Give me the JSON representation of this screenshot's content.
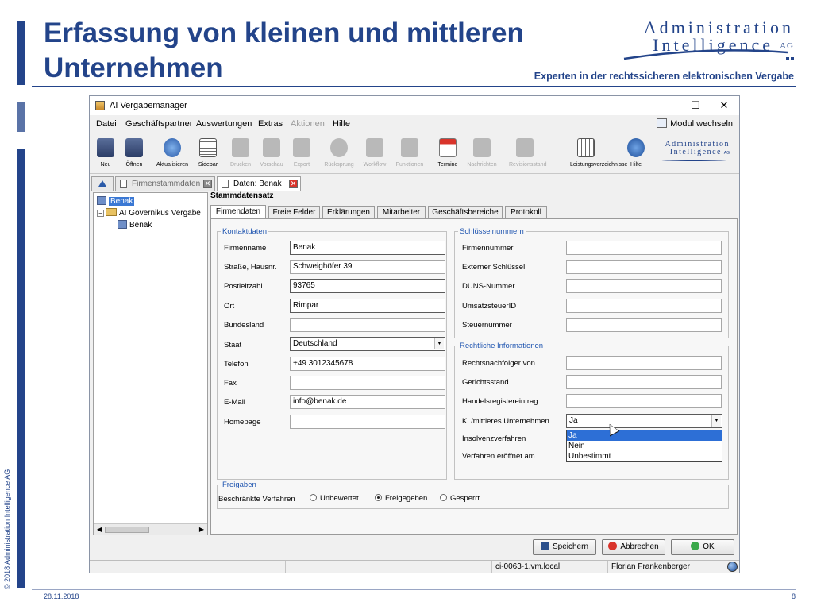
{
  "slide": {
    "title_line1": "Erfassung von kleinen und mittleren",
    "title_line2": "Unternehmen",
    "logo_line1": "Administration",
    "logo_line2": "Intelligence",
    "logo_suffix": "AG",
    "tagline": "Experten in der rechtssicheren elektronischen Vergabe",
    "footer_date": "28.11.2018",
    "page_number": "8",
    "copyright": "© 2018 Administration Intelligence AG",
    "accent_color": "#23448a"
  },
  "window": {
    "title": "AI Vergabemanager",
    "controls": {
      "minimize": "—",
      "maximize": "☐",
      "close": "✕"
    }
  },
  "menu": {
    "items": [
      "Datei",
      "Geschäftspartner",
      "Auswertungen",
      "Extras",
      "Aktionen",
      "Hilfe"
    ],
    "disabled": [
      "Aktionen"
    ],
    "modul_wechseln": "Modul wechseln"
  },
  "toolbar": {
    "buttons": [
      {
        "label": "Neu",
        "icon": "new-server-icon",
        "enabled": true
      },
      {
        "label": "Öffnen",
        "icon": "open-server-icon",
        "enabled": true
      },
      {
        "label": "Aktualisieren",
        "icon": "refresh-icon",
        "enabled": true
      },
      {
        "label": "Sidebar",
        "icon": "sidebar-icon",
        "enabled": true
      },
      {
        "label": "Drucken",
        "icon": "printer-icon",
        "enabled": false
      },
      {
        "label": "Vorschau",
        "icon": "preview-icon",
        "enabled": false
      },
      {
        "label": "Export",
        "icon": "export-icon",
        "enabled": false
      },
      {
        "label": "Rücksprung",
        "icon": "back-icon",
        "enabled": false
      },
      {
        "label": "Workflow",
        "icon": "workflow-icon",
        "enabled": false
      },
      {
        "label": "Funktionen",
        "icon": "functions-icon",
        "enabled": false
      },
      {
        "label": "Termine",
        "icon": "calendar-icon",
        "enabled": true
      },
      {
        "label": "Nachrichten",
        "icon": "mail-icon",
        "enabled": false
      },
      {
        "label": "Revisionsstand",
        "icon": "revision-icon",
        "enabled": false
      },
      {
        "label": "Leistungsverzeichnisse",
        "icon": "grid-icon",
        "enabled": true
      },
      {
        "label": "Hilfe",
        "icon": "help-icon",
        "enabled": true
      }
    ],
    "logo_line1": "Administration",
    "logo_line2": "Intelligence",
    "logo_suffix": "AG"
  },
  "doc_tabs": [
    {
      "label": "Firmenstammdaten",
      "active": false
    },
    {
      "label": "Daten: Benak",
      "active": true
    }
  ],
  "tree": {
    "nodes": [
      {
        "label": "Benak",
        "selected": true
      },
      {
        "label": "AI Governikus Vergabe",
        "selected": false
      },
      {
        "label": "Benak",
        "selected": false
      }
    ]
  },
  "section_title": "Stammdatensatz",
  "panel_tabs": [
    "Firmendaten",
    "Freie Felder",
    "Erklärungen",
    "Mitarbeiter",
    "Geschäftsbereiche",
    "Protokoll"
  ],
  "kontaktdaten": {
    "legend": "Kontaktdaten",
    "fields": [
      {
        "label": "Firmenname",
        "value": "Benak"
      },
      {
        "label": "Straße, Hausnr.",
        "value": "Schweighöfer 39"
      },
      {
        "label": "Postleitzahl",
        "value": "93765"
      },
      {
        "label": "Ort",
        "value": "Rimpar"
      },
      {
        "label": "Bundesland",
        "value": ""
      },
      {
        "label": "Staat",
        "value": "Deutschland"
      },
      {
        "label": "Telefon",
        "value": "+49 3012345678"
      },
      {
        "label": "Fax",
        "value": ""
      },
      {
        "label": "E-Mail",
        "value": "info@benak.de"
      },
      {
        "label": "Homepage",
        "value": ""
      }
    ]
  },
  "schluesselnummern": {
    "legend": "Schlüsselnummern",
    "fields": [
      {
        "label": "Firmennummer",
        "value": ""
      },
      {
        "label": "Externer Schlüssel",
        "value": ""
      },
      {
        "label": "DUNS-Nummer",
        "value": ""
      },
      {
        "label": "UmsatzsteuerID",
        "value": ""
      },
      {
        "label": "Steuernummer",
        "value": ""
      }
    ]
  },
  "rechtliche_informationen": {
    "legend": "Rechtliche Informationen",
    "fields": [
      {
        "label": "Rechtsnachfolger von",
        "value": ""
      },
      {
        "label": "Gerichtsstand",
        "value": ""
      },
      {
        "label": "Handelsregistereintrag",
        "value": ""
      },
      {
        "label": "Kl./mittleres Unternehmen",
        "value": "Ja"
      },
      {
        "label": "Insolvenzverfahren",
        "value": ""
      },
      {
        "label": "Verfahren eröffnet am",
        "value": ""
      }
    ],
    "dropdown_options": [
      "Ja",
      "Nein",
      "Unbestimmt"
    ],
    "dropdown_selected": "Ja"
  },
  "freigaben": {
    "legend": "Freigaben",
    "label": "Beschränkte Verfahren",
    "options": [
      "Unbewertet",
      "Freigegeben",
      "Gesperrt"
    ],
    "selected": "Freigegeben"
  },
  "buttons": {
    "save": "Speichern",
    "cancel": "Abbrechen",
    "ok": "OK"
  },
  "statusbar": {
    "host": "ci-0063-1.vm.local",
    "user": "Florian Frankenberger"
  }
}
